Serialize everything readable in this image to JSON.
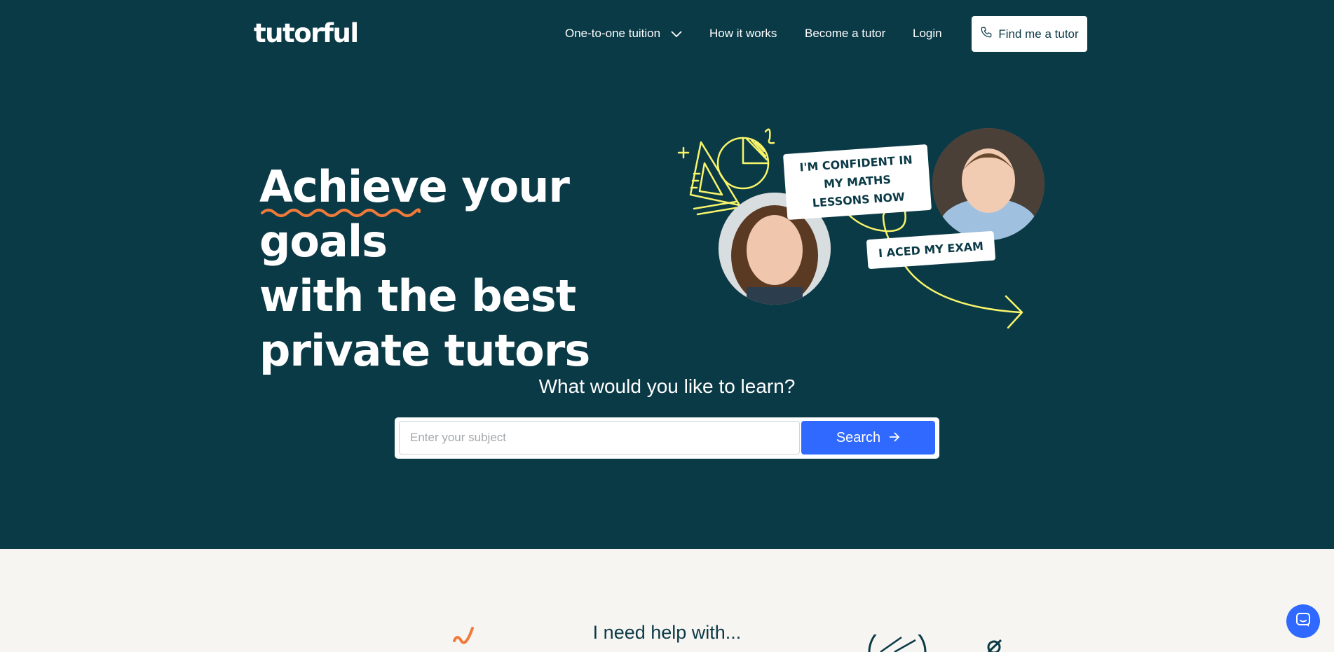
{
  "header": {
    "logo": "tutorful",
    "nav": [
      {
        "label": "One-to-one tuition"
      },
      {
        "label": "How it works"
      },
      {
        "label": "Become a tutor"
      },
      {
        "label": "Login"
      }
    ],
    "cta_label": "Find me a tutor"
  },
  "hero": {
    "headline_line1_highlight": "Achieve",
    "headline_line1_rest": " your goals",
    "headline_line2": "with the best",
    "headline_line3": "private tutors",
    "quote_1": "I'M CONFIDENT IN MY MATHS LESSONS NOW",
    "quote_2": "I ACED MY EXAM"
  },
  "search": {
    "question": "What would you like to learn?",
    "placeholder": "Enter your subject",
    "value": "",
    "button_label": "Search"
  },
  "below": {
    "help_heading": "I need help with..."
  },
  "colors": {
    "hero_bg": "#0b3a47",
    "accent_yellow": "#f7f56a",
    "accent_orange": "#f07a3a",
    "button_blue": "#3069ff",
    "page_bg": "#f7f5f1"
  }
}
